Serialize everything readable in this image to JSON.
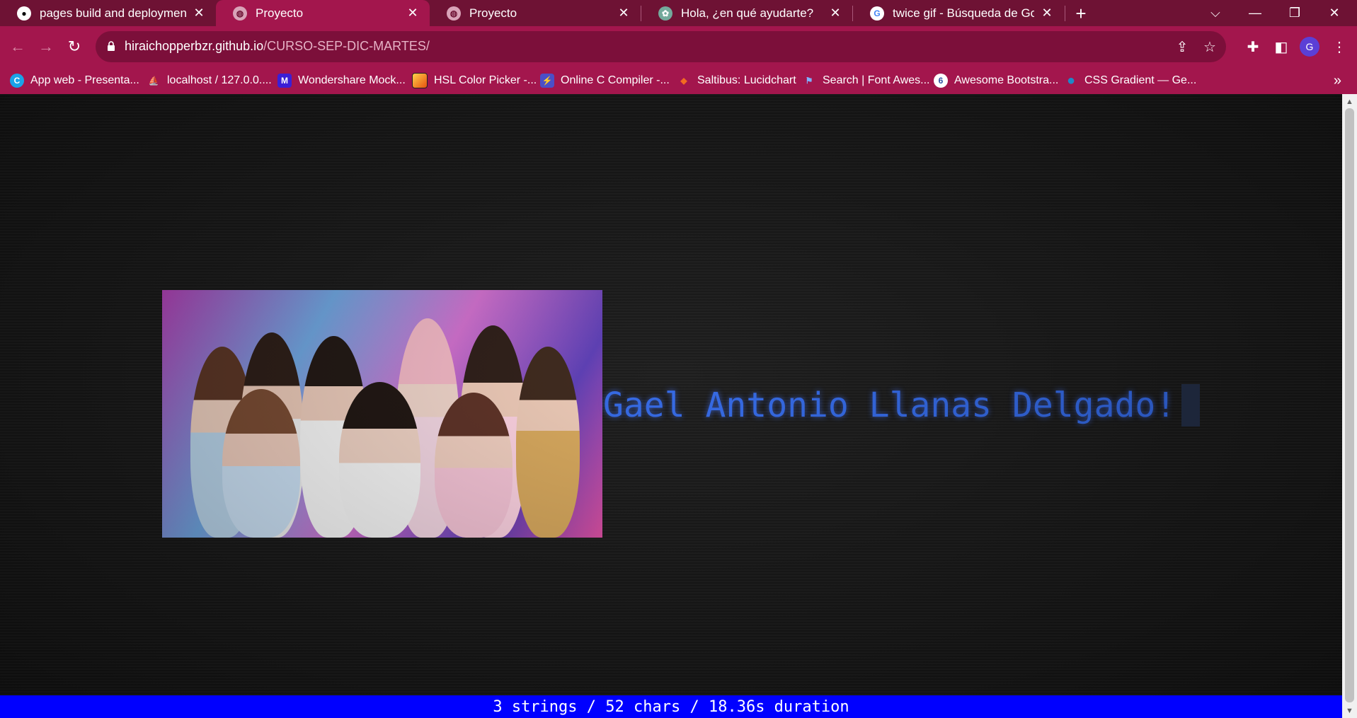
{
  "browser": {
    "tabs": [
      {
        "title": "pages build and deployment · Hi",
        "favicon": "github-icon",
        "active": false
      },
      {
        "title": "Proyecto",
        "favicon": "globe-icon",
        "active": true
      },
      {
        "title": "Proyecto",
        "favicon": "globe-icon",
        "active": false
      },
      {
        "title": "Hola, ¿en qué ayudarte?",
        "favicon": "chatgpt-icon",
        "active": false
      },
      {
        "title": "twice gif - Búsqueda de Google",
        "favicon": "google-icon",
        "active": false
      }
    ],
    "new_tab_glyph": "+",
    "window_controls": {
      "tab_search": "⌵",
      "minimize": "—",
      "maximize": "❐",
      "close": "✕"
    },
    "nav": {
      "back": "←",
      "forward": "→",
      "reload": "↻"
    },
    "address": {
      "host": "hiraichopperbzr.github.io",
      "path": "/CURSO-SEP-DIC-MARTES/"
    },
    "bookmarks": [
      {
        "label": "App web - Presenta...",
        "icon": "canva-icon",
        "color": "#1aa3e8",
        "glyph": "C"
      },
      {
        "label": "localhost / 127.0.0....",
        "icon": "phpmyadmin-icon",
        "color": "#f39c12",
        "glyph": "⛵"
      },
      {
        "label": "Wondershare Mock...",
        "icon": "mockitt-icon",
        "color": "#3b1fd6",
        "glyph": "M"
      },
      {
        "label": "HSL Color Picker -...",
        "icon": "color-picker-icon",
        "color": "#f5a623",
        "glyph": ""
      },
      {
        "label": "Online C Compiler -...",
        "icon": "compiler-icon",
        "color": "#4b4fc7",
        "glyph": "⚡"
      },
      {
        "label": "Saltibus: Lucidchart",
        "icon": "lucidchart-icon",
        "color": "#f26b21",
        "glyph": "◆"
      },
      {
        "label": "Search | Font Awes...",
        "icon": "fontawesome-icon",
        "color": "#2a6fdb",
        "glyph": "⚑"
      },
      {
        "label": "Awesome Bootstra...",
        "icon": "bootstrap-icon",
        "color": "#2d4fa1",
        "glyph": "6"
      },
      {
        "label": "CSS Gradient — Ge...",
        "icon": "css-gradient-icon",
        "color": "#1e88c7",
        "glyph": "●"
      }
    ],
    "bookmarks_more": "»",
    "profile_initial": "G",
    "colors": {
      "frame": "#6e1234",
      "toolbar": "#a3164d",
      "omnibox": "#7c0f3a"
    }
  },
  "page": {
    "typed_text": "Gael Antonio Llanas Delgado!",
    "status": "3 strings / 52 chars / 18.36s duration",
    "image_alt": "twice gif",
    "colors": {
      "typed": "#2f66e6",
      "status_bar": "#0000ff"
    }
  }
}
